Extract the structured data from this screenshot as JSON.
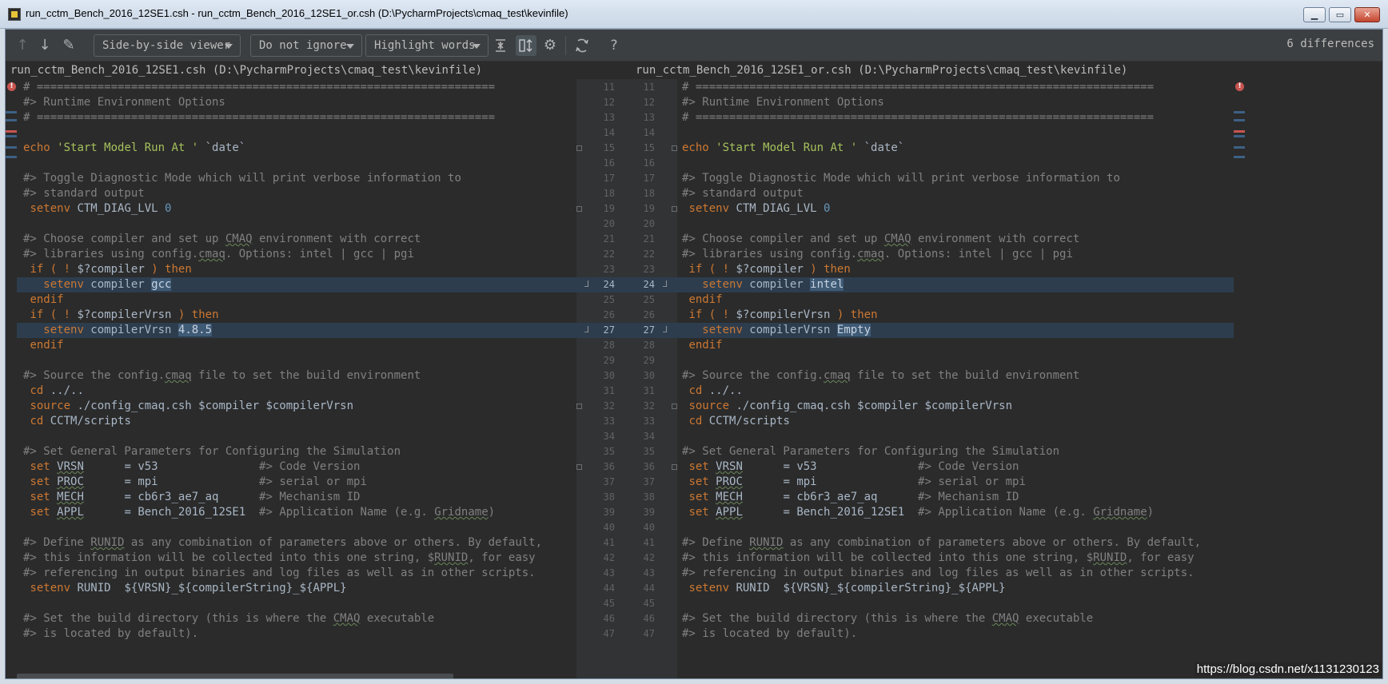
{
  "window": {
    "title": "run_cctm_Bench_2016_12SE1.csh - run_cctm_Bench_2016_12SE1_or.csh (D:\\PycharmProjects\\cmaq_test\\kevinfile)"
  },
  "toolbar": {
    "viewer_mode": "Side-by-side viewer",
    "whitespace_mode": "Do not ignore",
    "highlight_mode": "Highlight words",
    "diff_count": "6 differences",
    "help_label": "?"
  },
  "left_header": "run_cctm_Bench_2016_12SE1.csh (D:\\PycharmProjects\\cmaq_test\\kevinfile)",
  "right_header": "run_cctm_Bench_2016_12SE1_or.csh (D:\\PycharmProjects\\cmaq_test\\kevinfile)",
  "line_numbers": [
    "11",
    "12",
    "13",
    "14",
    "15",
    "16",
    "17",
    "18",
    "19",
    "20",
    "21",
    "22",
    "23",
    "24",
    "25",
    "26",
    "27",
    "28",
    "29",
    "30",
    "31",
    "32",
    "33",
    "34",
    "35",
    "36",
    "37",
    "38",
    "39",
    "40",
    "41",
    "42",
    "43",
    "44",
    "45",
    "46",
    "47"
  ],
  "left_code": [
    "# ====================================================================",
    "#> Runtime Environment Options",
    "# ====================================================================",
    "",
    "echo 'Start Model Run At ' `date`",
    "",
    "#> Toggle Diagnostic Mode which will print verbose information to",
    "#> standard output",
    " setenv CTM_DIAG_LVL 0",
    "",
    "#> Choose compiler and set up CMAQ environment with correct",
    "#> libraries using config.cmaq. Options: intel | gcc | pgi",
    " if ( ! $?compiler ) then",
    "   setenv compiler gcc",
    " endif",
    " if ( ! $?compilerVrsn ) then",
    "   setenv compilerVrsn 4.8.5",
    " endif",
    "",
    "#> Source the config.cmaq file to set the build environment",
    " cd ../..",
    " source ./config_cmaq.csh $compiler $compilerVrsn",
    " cd CCTM/scripts",
    "",
    "#> Set General Parameters for Configuring the Simulation",
    " set VRSN      = v53               #> Code Version",
    " set PROC      = mpi               #> serial or mpi",
    " set MECH      = cb6r3_ae7_aq      #> Mechanism ID",
    " set APPL      = Bench_2016_12SE1  #> Application Name (e.g. Gridname)",
    "",
    "#> Define RUNID as any combination of parameters above or others. By default,",
    "#> this information will be collected into this one string, $RUNID, for easy",
    "#> referencing in output binaries and log files as well as in other scripts.",
    " setenv RUNID  ${VRSN}_${compilerString}_${APPL}",
    "",
    "#> Set the build directory (this is where the CMAQ executable",
    "#> is located by default)."
  ],
  "right_code": [
    "# ====================================================================",
    "#> Runtime Environment Options",
    "# ====================================================================",
    "",
    "echo 'Start Model Run At ' `date`",
    "",
    "#> Toggle Diagnostic Mode which will print verbose information to",
    "#> standard output",
    " setenv CTM_DIAG_LVL 0",
    "",
    "#> Choose compiler and set up CMAQ environment with correct",
    "#> libraries using config.cmaq. Options: intel | gcc | pgi",
    " if ( ! $?compiler ) then",
    "   setenv compiler intel",
    " endif",
    " if ( ! $?compilerVrsn ) then",
    "   setenv compilerVrsn Empty",
    " endif",
    "",
    "#> Source the config.cmaq file to set the build environment",
    " cd ../..",
    " source ./config_cmaq.csh $compiler $compilerVrsn",
    " cd CCTM/scripts",
    "",
    "#> Set General Parameters for Configuring the Simulation",
    " set VRSN      = v53               #> Code Version",
    " set PROC      = mpi               #> serial or mpi",
    " set MECH      = cb6r3_ae7_aq      #> Mechanism ID",
    " set APPL      = Bench_2016_12SE1  #> Application Name (e.g. Gridname)",
    "",
    "#> Define RUNID as any combination of parameters above or others. By default,",
    "#> this information will be collected into this one string, $RUNID, for easy",
    "#> referencing in output binaries and log files as well as in other scripts.",
    " setenv RUNID  ${VRSN}_${compilerString}_${APPL}",
    "",
    "#> Set the build directory (this is where the CMAQ executable",
    "#> is located by default)."
  ],
  "changed_rows": [
    13,
    16
  ],
  "colors": {
    "background": "#2b2b2b",
    "comment": "#808080",
    "keyword": "#cc7832",
    "number": "#6897bb",
    "changed_line": "#2d3d4e",
    "word_highlight": "#3f5a75"
  },
  "watermark": "https://blog.csdn.net/x1131230123"
}
